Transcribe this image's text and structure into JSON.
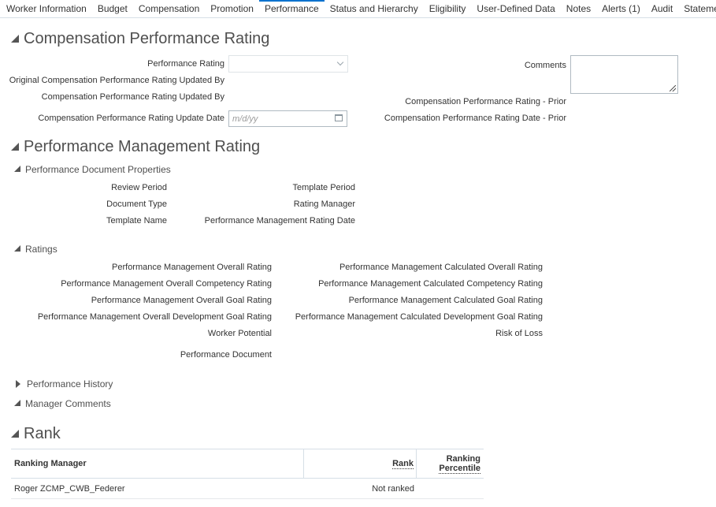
{
  "tabs": [
    "Worker Information",
    "Budget",
    "Compensation",
    "Promotion",
    "Performance",
    "Status and Hierarchy",
    "Eligibility",
    "User-Defined Data",
    "Notes",
    "Alerts (1)",
    "Audit",
    "Statement"
  ],
  "active_tab": "Performance",
  "comp_perf": {
    "title": "Compensation Performance Rating",
    "performance_rating_label": "Performance Rating",
    "performance_rating_value": "",
    "original_updated_by_label": "Original Compensation Performance Rating Updated By",
    "updated_by_label": "Compensation Performance Rating Updated By",
    "update_date_label": "Compensation Performance Rating Update Date",
    "update_date_placeholder": "m/d/yy",
    "comments_label": "Comments",
    "comments_value": "",
    "rating_prior_label": "Compensation Performance Rating - Prior",
    "rating_date_prior_label": "Compensation Performance Rating Date - Prior"
  },
  "perf_mgmt": {
    "title": "Performance Management Rating",
    "doc_props": {
      "title": "Performance Document Properties",
      "review_period": "Review Period",
      "document_type": "Document Type",
      "template_name": "Template Name",
      "template_period": "Template Period",
      "rating_manager": "Rating Manager",
      "rating_date": "Performance Management Rating Date"
    },
    "ratings": {
      "title": "Ratings",
      "overall_rating": "Performance Management Overall Rating",
      "overall_competency": "Performance Management Overall Competency Rating",
      "overall_goal": "Performance Management Overall Goal Rating",
      "overall_development": "Performance Management Overall Development Goal Rating",
      "worker_potential": "Worker Potential",
      "performance_document": "Performance Document",
      "calc_overall": "Performance Management Calculated Overall Rating",
      "calc_competency": "Performance Management Calculated Competency Rating",
      "calc_goal": "Performance Management Calculated Goal Rating",
      "calc_development": "Performance Management Calculated Development Goal Rating",
      "risk_of_loss": "Risk of Loss"
    },
    "history_title": "Performance History",
    "manager_comments_title": "Manager Comments"
  },
  "rank": {
    "title": "Rank",
    "columns": {
      "manager": "Ranking Manager",
      "rank": "Rank",
      "percentile_line1": "Ranking",
      "percentile_line2": "Percentile"
    },
    "rows": [
      {
        "manager": "Roger ZCMP_CWB_Federer",
        "rank": "Not ranked",
        "percentile": ""
      }
    ]
  }
}
